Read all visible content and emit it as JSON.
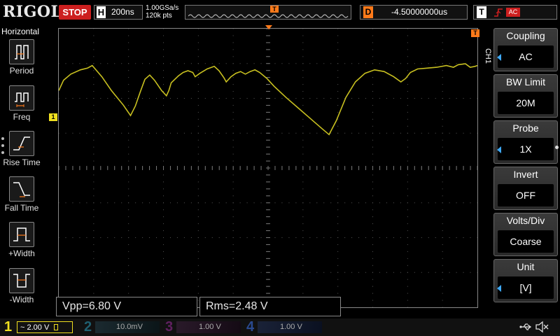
{
  "brand": "RIGOL",
  "run_state": "STOP",
  "horizontal": {
    "label": "H",
    "timebase": "200ns",
    "sample_rate": "1.00GSa/s",
    "mem_depth": "120k pts"
  },
  "trigger_position": {
    "label": "T"
  },
  "delay": {
    "label": "D",
    "value": "-4.50000000us"
  },
  "trigger": {
    "label": "T",
    "coupling_badge": "AC"
  },
  "left_menu": {
    "title": "Horizontal",
    "items": [
      {
        "label": "Period",
        "icon": "period-icon"
      },
      {
        "label": "Freq",
        "icon": "frequency-icon"
      },
      {
        "label": "Rise Time",
        "icon": "rise-time-icon"
      },
      {
        "label": "Fall Time",
        "icon": "fall-time-icon"
      },
      {
        "label": "+Width",
        "icon": "positive-width-icon"
      },
      {
        "label": "-Width",
        "icon": "negative-width-icon"
      }
    ]
  },
  "markers": {
    "ch1": "1",
    "trigger_level": "T"
  },
  "measurements": [
    {
      "text": "Vpp=6.80 V"
    },
    {
      "text": "Rms=2.48 V"
    }
  ],
  "right_menu": {
    "channel_tab": "CH1",
    "items": [
      {
        "title": "Coupling",
        "value": "AC",
        "has_arrow": true
      },
      {
        "title": "BW Limit",
        "value": "20M",
        "has_arrow": false
      },
      {
        "title": "Probe",
        "value": "1X",
        "has_arrow": true
      },
      {
        "title": "Invert",
        "value": "OFF",
        "has_arrow": false
      },
      {
        "title": "Volts/Div",
        "value": "Coarse",
        "has_arrow": false
      },
      {
        "title": "Unit",
        "value": "[V]",
        "has_arrow": true
      }
    ]
  },
  "channels": [
    {
      "num": "1",
      "coupling": "~",
      "scale": "2.00 V",
      "color": "#f0e020",
      "active": true
    },
    {
      "num": "2",
      "coupling": "",
      "scale": "10.0mV",
      "color": "#1f9fbf",
      "active": false
    },
    {
      "num": "3",
      "coupling": "",
      "scale": "1.00 V",
      "color": "#c030c0",
      "active": false
    },
    {
      "num": "4",
      "coupling": "",
      "scale": "1.00 V",
      "color": "#3070e0",
      "active": false
    }
  ],
  "colors": {
    "trace": "#c8c020",
    "trigger": "#ff7a1a",
    "stop": "#cc1f1f",
    "accent_arrow": "#3fa9f5"
  },
  "waveform": {
    "points": [
      [
        0,
        0.7
      ],
      [
        0.02,
        0.58
      ],
      [
        0.05,
        0.51
      ],
      [
        0.09,
        0.46
      ],
      [
        0.12,
        0.44
      ],
      [
        0.14,
        0.41
      ],
      [
        0.18,
        0.54
      ],
      [
        0.22,
        0.7
      ],
      [
        0.27,
        0.87
      ],
      [
        0.3,
        0.99
      ],
      [
        0.32,
        0.88
      ],
      [
        0.34,
        0.72
      ],
      [
        0.36,
        0.57
      ],
      [
        0.38,
        0.52
      ],
      [
        0.4,
        0.58
      ],
      [
        0.43,
        0.7
      ],
      [
        0.45,
        0.76
      ],
      [
        0.46,
        0.7
      ],
      [
        0.47,
        0.61
      ],
      [
        0.5,
        0.53
      ],
      [
        0.52,
        0.49
      ],
      [
        0.54,
        0.47
      ],
      [
        0.56,
        0.49
      ],
      [
        0.57,
        0.54
      ],
      [
        0.59,
        0.5
      ],
      [
        0.62,
        0.45
      ],
      [
        0.65,
        0.42
      ],
      [
        0.67,
        0.47
      ],
      [
        0.69,
        0.55
      ],
      [
        0.7,
        0.6
      ],
      [
        0.72,
        0.54
      ],
      [
        0.74,
        0.5
      ],
      [
        0.76,
        0.48
      ],
      [
        0.78,
        0.51
      ],
      [
        0.8,
        0.48
      ],
      [
        0.82,
        0.46
      ],
      [
        0.84,
        0.49
      ],
      [
        0.87,
        0.56
      ],
      [
        0.9,
        0.65
      ],
      [
        0.95,
        0.78
      ],
      [
        1.0,
        0.9
      ],
      [
        1.05,
        1.02
      ],
      [
        1.1,
        1.14
      ],
      [
        1.13,
        1.21
      ],
      [
        1.16,
        1.05
      ],
      [
        1.2,
        0.78
      ],
      [
        1.24,
        0.6
      ],
      [
        1.28,
        0.5
      ],
      [
        1.32,
        0.46
      ],
      [
        1.36,
        0.48
      ],
      [
        1.4,
        0.54
      ],
      [
        1.43,
        0.6
      ],
      [
        1.45,
        0.56
      ],
      [
        1.47,
        0.49
      ],
      [
        1.5,
        0.45
      ],
      [
        1.54,
        0.44
      ],
      [
        1.58,
        0.43
      ],
      [
        1.62,
        0.41
      ],
      [
        1.65,
        0.43
      ],
      [
        1.67,
        0.4
      ],
      [
        1.7,
        0.39
      ],
      [
        1.72,
        0.43
      ],
      [
        1.74,
        0.42
      ],
      [
        1.75,
        0.41
      ]
    ]
  }
}
